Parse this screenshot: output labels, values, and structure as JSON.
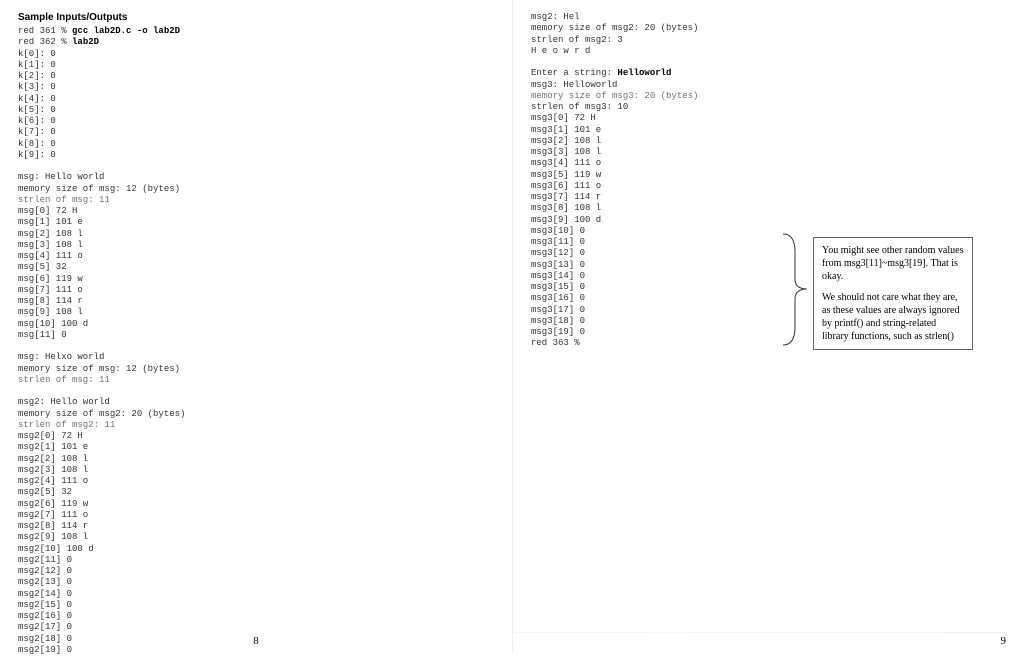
{
  "left": {
    "heading": "Sample Inputs/Outputs",
    "compile_line_prefix": "red 361 % ",
    "compile_line_cmd": "gcc lab2D.c -o lab2D",
    "run_line_prefix": "red 362 % ",
    "run_line_cmd": "lab2D",
    "k_array": [
      "k[0]: 0",
      "k[1]: 0",
      "k[2]: 0",
      "k[3]: 0",
      "k[4]: 0",
      "k[5]: 0",
      "k[6]: 0",
      "k[7]: 0",
      "k[8]: 0",
      "k[9]: 0"
    ],
    "blank1": "",
    "msg_block": [
      "msg: Hello world",
      "memory size of msg: 12 (bytes)",
      "strlen of msg: 11",
      "msg[0] 72 H",
      "msg[1] 101 e",
      "msg[2] 108 l",
      "msg[3] 108 l",
      "msg[4] 111 o",
      "msg[5] 32 ",
      "msg[6] 119 w",
      "msg[7] 111 o",
      "msg[8] 114 r",
      "msg[9] 108 l",
      "msg[10] 100 d",
      "msg[11] 0"
    ],
    "blank2": "",
    "msg_helxo": [
      "msg: Helxo world",
      "memory size of msg: 12 (bytes)",
      "strlen of msg: 11"
    ],
    "blank3": "",
    "msg2_block": [
      "msg2: Hello world",
      "memory size of msg2: 20 (bytes)",
      "strlen of msg2: 11",
      "msg2[0] 72 H",
      "msg2[1] 101 e",
      "msg2[2] 108 l",
      "msg2[3] 108 l",
      "msg2[4] 111 o",
      "msg2[5] 32 ",
      "msg2[6] 119 w",
      "msg2[7] 111 o",
      "msg2[8] 114 r",
      "msg2[9] 108 l",
      "msg2[10] 100 d",
      "msg2[11] 0",
      "msg2[12] 0",
      "msg2[13] 0",
      "msg2[14] 0",
      "msg2[15] 0",
      "msg2[16] 0",
      "msg2[17] 0",
      "msg2[18] 0",
      "msg2[19] 0"
    ],
    "page_num": "8"
  },
  "right": {
    "msg2_tail": [
      "msg2: Hel",
      "memory size of msg2: 20 (bytes)",
      "strlen of msg2: 3",
      "H e o w r d"
    ],
    "blank1": "",
    "enter_prefix": "Enter a string: ",
    "enter_bold": "Helloworld",
    "msg3_block": [
      "msg3: Helloworld",
      "memory size of msg3: 20 (bytes)",
      "strlen of msg3: 10",
      "msg3[0] 72 H",
      "msg3[1] 101 e",
      "msg3[2] 108 l",
      "msg3[3] 108 l",
      "msg3[4] 111 o",
      "msg3[5] 119 w",
      "msg3[6] 111 o",
      "msg3[7] 114 r",
      "msg3[8] 108 l",
      "msg3[9] 100 d",
      "msg3[10] 0",
      "msg3[11] 0",
      "msg3[12] 0",
      "msg3[13] 0",
      "msg3[14] 0",
      "msg3[15] 0",
      "msg3[16] 0",
      "msg3[17] 0",
      "msg3[18] 0",
      "msg3[19] 0",
      "red 363 %"
    ],
    "callout_p1": "You might see other random values from msg3[11]~msg3[19]. That is okay.",
    "callout_p2": "We should not care what they are, as these values are always ignored by printf() and string-related library functions, such as strlen()",
    "page_num": "9"
  }
}
